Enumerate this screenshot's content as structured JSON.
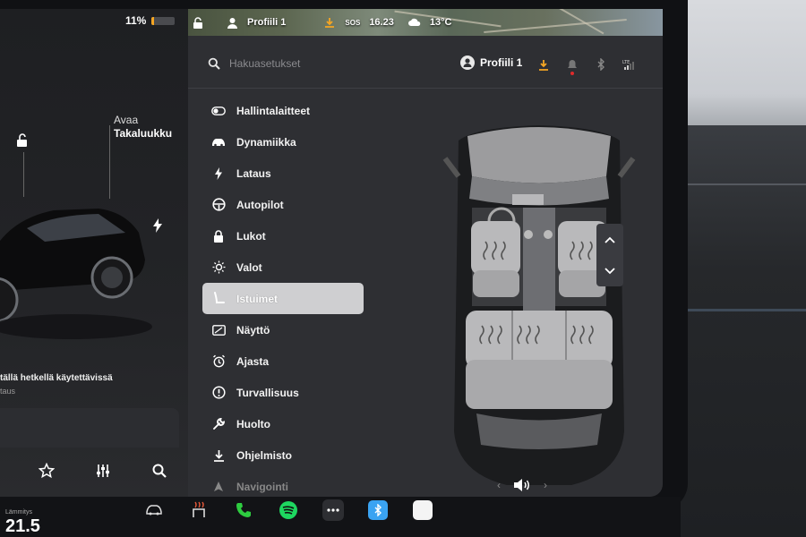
{
  "battery": {
    "percent_text": "11%",
    "level": 0.11,
    "color": "#f5a623"
  },
  "car_panel": {
    "trunk_action": "Avaa",
    "trunk_name": "Takaluukku",
    "unavailable_text": "tällä hetkellä käytettävissä",
    "unavailable_sub": "taus",
    "actions": [
      {
        "icon": "star-icon"
      },
      {
        "icon": "sliders-icon"
      },
      {
        "icon": "search-icon"
      }
    ]
  },
  "status_bar": {
    "profile_name": "Profiili 1",
    "sos": "SOS",
    "time": "16.23",
    "temperature": "13°C"
  },
  "header": {
    "search_placeholder": "Hakuasetukset",
    "profile_name": "Profiili 1",
    "icons": [
      "download-icon",
      "bell-icon",
      "bluetooth-icon",
      "lte-signal-icon"
    ]
  },
  "menu": {
    "active_index": 6,
    "items": [
      {
        "label": "Hallintalaitteet",
        "icon": "toggle-icon"
      },
      {
        "label": "Dynamiikka",
        "icon": "car-icon"
      },
      {
        "label": "Lataus",
        "icon": "bolt-icon"
      },
      {
        "label": "Autopilot",
        "icon": "steering-wheel-icon"
      },
      {
        "label": "Lukot",
        "icon": "lock-icon"
      },
      {
        "label": "Valot",
        "icon": "sun-icon"
      },
      {
        "label": "Istuimet",
        "icon": "seat-icon"
      },
      {
        "label": "Näyttö",
        "icon": "display-icon"
      },
      {
        "label": "Ajasta",
        "icon": "alarm-clock-icon"
      },
      {
        "label": "Turvallisuus",
        "icon": "alert-circle-icon"
      },
      {
        "label": "Huolto",
        "icon": "wrench-icon"
      },
      {
        "label": "Ohjelmisto",
        "icon": "download-icon"
      },
      {
        "label": "Navigointi",
        "icon": "navigation-icon"
      }
    ]
  },
  "dock": {
    "temp_label": "Lämmitys",
    "temp_value": "21.5",
    "apps": [
      "car-icon",
      "seat-heater-icon",
      "phone-icon",
      "spotify-icon",
      "more-apps-icon",
      "bluetooth-app-icon",
      "notes-app-icon"
    ],
    "volume_left": "‹",
    "volume_right": "›"
  },
  "colors": {
    "accent_orange": "#f5a623",
    "phone_green": "#2ecc40",
    "spotify_green": "#1ed760",
    "bluetooth_blue": "#3aa3f2"
  }
}
